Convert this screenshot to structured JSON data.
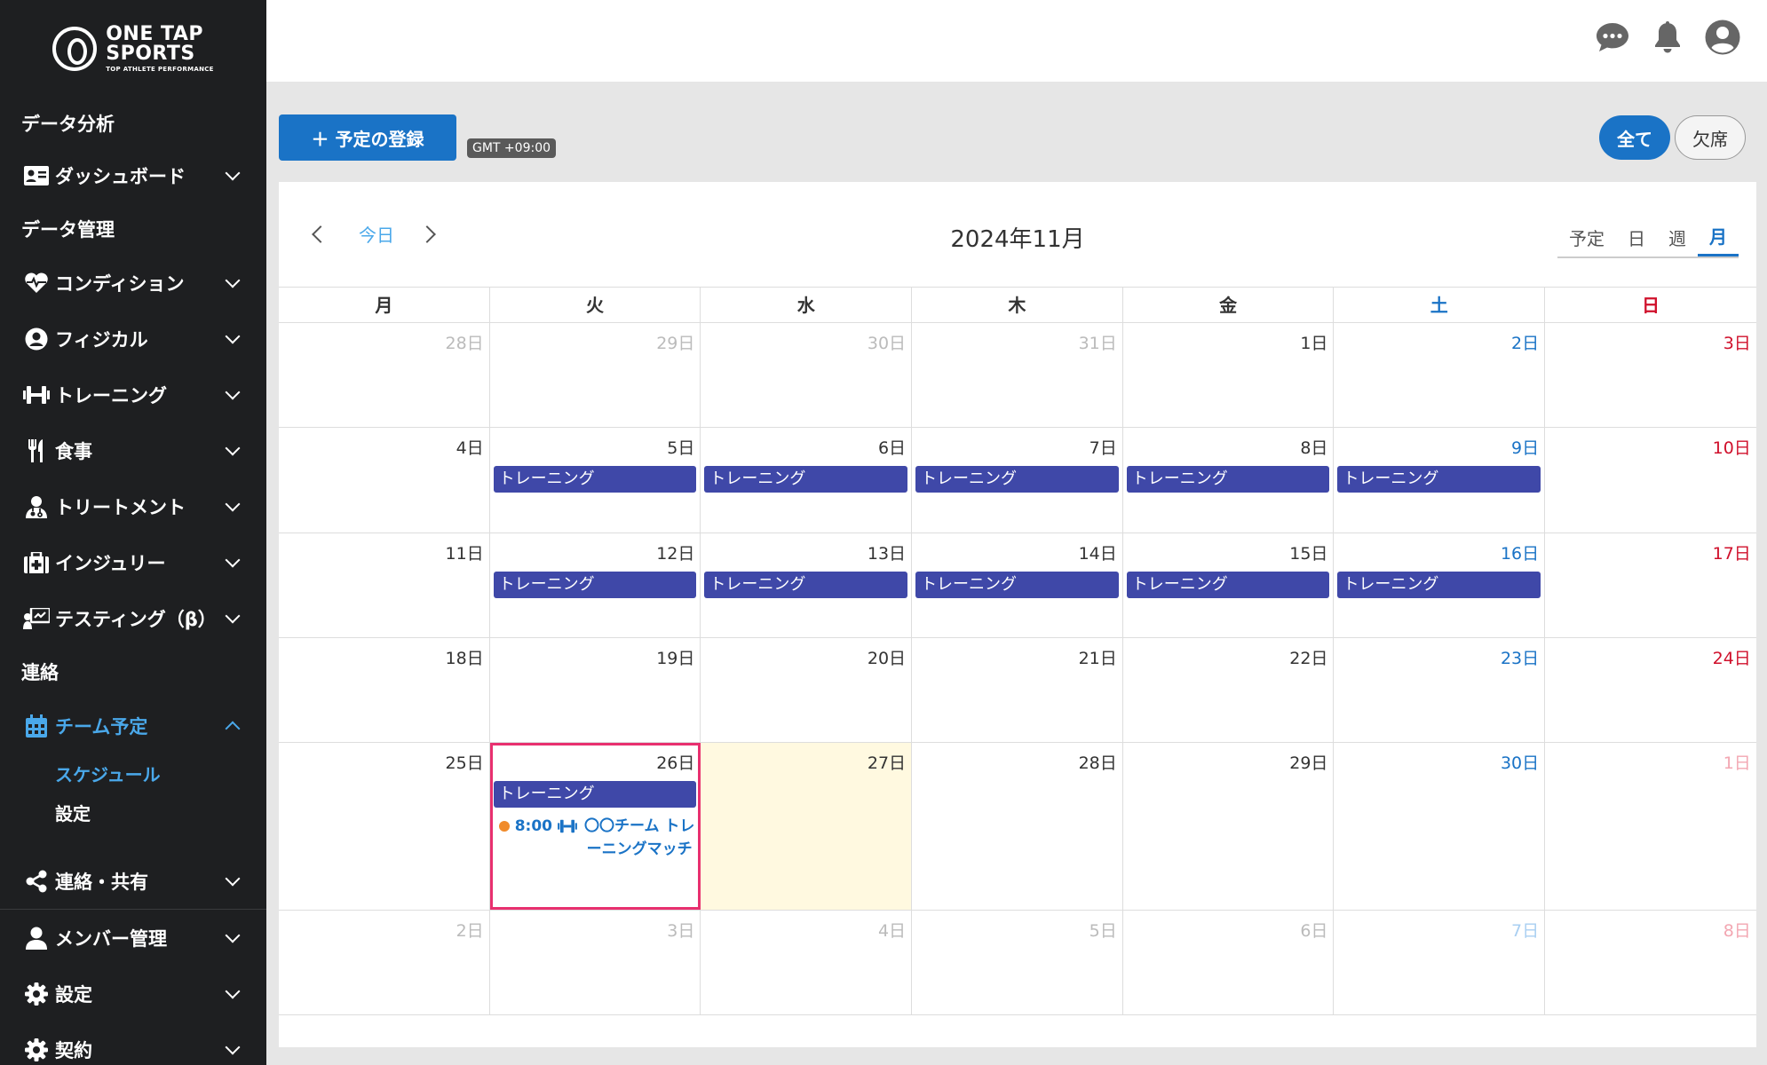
{
  "brand": {
    "line1": "ONE TAP",
    "line2": "SPORTS",
    "line3": "TOP ATHLETE PERFORMANCE"
  },
  "sidebar": {
    "section_data_analysis": "データ分析",
    "dashboard": "ダッシュボード",
    "section_data_management": "データ管理",
    "condition": "コンディション",
    "physical": "フィジカル",
    "training": "トレーニング",
    "meal": "食事",
    "treatment": "トリートメント",
    "injury": "インジュリー",
    "testing": "テスティング（β）",
    "section_contact": "連絡",
    "team_schedule": "チーム予定",
    "schedule": "スケジュール",
    "team_settings": "設定",
    "contact_share": "連絡・共有",
    "member_management": "メンバー管理",
    "settings": "設定",
    "contract": "契約"
  },
  "toolbar": {
    "add_event": "＋ 予定の登録",
    "timezone": "GMT +09:00",
    "filter_all": "全て",
    "filter_absent": "欠席"
  },
  "calendar": {
    "today": "今日",
    "title": "2024年11月",
    "views": [
      "予定",
      "日",
      "週",
      "月"
    ],
    "weekdays": [
      "月",
      "火",
      "水",
      "木",
      "金",
      "土",
      "日"
    ],
    "weeks": [
      [
        "28日",
        "29日",
        "30日",
        "31日",
        "1日",
        "2日",
        "3日"
      ],
      [
        "4日",
        "5日",
        "6日",
        "7日",
        "8日",
        "9日",
        "10日"
      ],
      [
        "11日",
        "12日",
        "13日",
        "14日",
        "15日",
        "16日",
        "17日"
      ],
      [
        "18日",
        "19日",
        "20日",
        "21日",
        "22日",
        "23日",
        "24日"
      ],
      [
        "25日",
        "26日",
        "27日",
        "28日",
        "29日",
        "30日",
        "1日"
      ],
      [
        "2日",
        "3日",
        "4日",
        "5日",
        "6日",
        "7日",
        "8日"
      ]
    ],
    "event_label": "トレーニング",
    "timed_event": {
      "time": "8:00",
      "title": "〇〇チーム トレーニングマッチ"
    }
  },
  "colors": {
    "primary": "#1a73c6",
    "event": "#3f48a8",
    "saturday": "#1a73c6",
    "sunday": "#d0102b",
    "selected_outline": "#e8306f",
    "today_bg": "#fff9e0",
    "sidebar_bg": "#1e1f21"
  }
}
